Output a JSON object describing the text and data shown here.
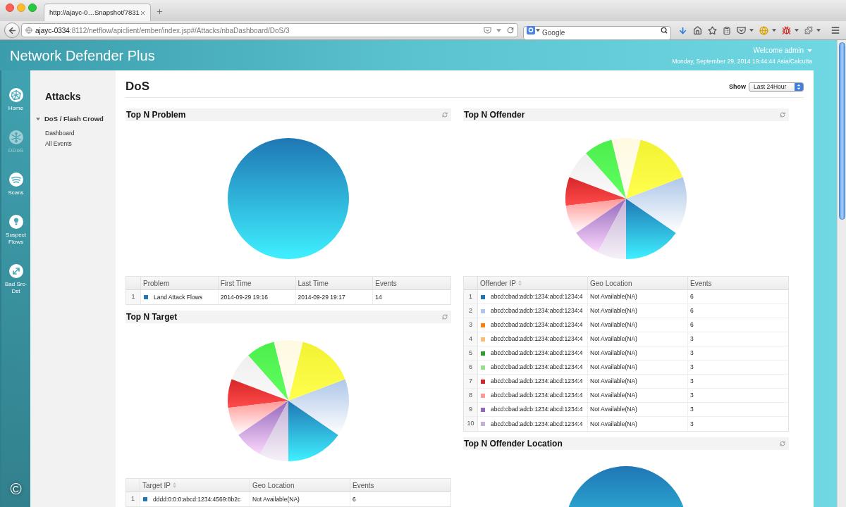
{
  "browser": {
    "tab_title": "http://ajayc-0…Snapshot/7831",
    "address": {
      "host": "ajayc-0334",
      "path": ":8112/netflow/apiclient/ember/index.jsp#/Attacks/nbaDashboard/DoS/3"
    },
    "search": {
      "placeholder": "Google"
    }
  },
  "header": {
    "title": "Network Defender Plus",
    "user": "Welcome admin",
    "datetime": "Monday, September 29, 2014 19:44:44 Asia/Calcutta"
  },
  "nav_rail": {
    "items": [
      {
        "label": "Home",
        "kind": "globe",
        "selected": false
      },
      {
        "label": "DDoS",
        "kind": "snowflake",
        "selected": true
      },
      {
        "label": "Scans",
        "kind": "waves",
        "selected": false
      },
      {
        "label": "Suspect Flows",
        "kind": "bulb",
        "selected": false
      },
      {
        "label": "Bad Src-Dst",
        "kind": "arrows",
        "selected": false
      }
    ],
    "footer": "©"
  },
  "sidebar": {
    "title": "Attacks",
    "groups": [
      {
        "label": "DoS / Flash Crowd",
        "expanded": true,
        "children": [
          {
            "label": "Dashboard"
          },
          {
            "label": "All Events"
          }
        ]
      }
    ]
  },
  "main": {
    "title": "DoS",
    "show": {
      "label": "Show",
      "value": "Last 24Hour"
    },
    "left_column": [
      {
        "title": "Top N Problem",
        "kind": "solid",
        "table": {
          "columns": [
            {
              "label": "Problem",
              "sortable": false
            },
            {
              "label": "First Time",
              "sortable": false
            },
            {
              "label": "Last Time",
              "sortable": false
            },
            {
              "label": "Events",
              "sortable": false
            }
          ],
          "rows": [
            {
              "index": "1",
              "color": "#1f77b4",
              "cells": [
                "Land Attack Flows",
                "2014-09-29 19:16",
                "2014-09-29 19:17",
                "14"
              ]
            }
          ]
        }
      },
      {
        "title": "Top N Target",
        "kind": "sliced",
        "table": {
          "columns": [
            {
              "label": "Target IP",
              "sortable": true
            },
            {
              "label": "Geo Location",
              "sortable": false
            },
            {
              "label": "Events",
              "sortable": false
            }
          ],
          "rows": [
            {
              "index": "1",
              "color": "#1f77b4",
              "cells": [
                "dddd:0:0:0:abcd:1234:4569:8b2c",
                "Not Available(NA)",
                "6"
              ]
            }
          ]
        }
      }
    ],
    "right_column": [
      {
        "title": "Top N Offender",
        "kind": "sliced",
        "table": {
          "columns": [
            {
              "label": "Offender IP",
              "sortable": true
            },
            {
              "label": "Geo Location",
              "sortable": false
            },
            {
              "label": "Events",
              "sortable": false
            }
          ],
          "rows": [
            {
              "index": "1",
              "color": "#1f77b4",
              "cells": [
                "abcd:cbad:adcb:1234:abcd:1234:4",
                "Not Available(NA)",
                "6"
              ]
            },
            {
              "index": "2",
              "color": "#aec7e8",
              "cells": [
                "abcd:cbad:adcb:1234:abcd:1234:4",
                "Not Available(NA)",
                "6"
              ]
            },
            {
              "index": "3",
              "color": "#ff7f0e",
              "cells": [
                "abcd:cbad:adcb:1234:abcd:1234:4",
                "Not Available(NA)",
                "6"
              ]
            },
            {
              "index": "4",
              "color": "#ffbb78",
              "cells": [
                "abcd:cbad:adcb:1234:abcd:1234:4",
                "Not Available(NA)",
                "3"
              ]
            },
            {
              "index": "5",
              "color": "#2ca02c",
              "cells": [
                "abcd:cbad:adcb:1234:abcd:1234:4",
                "Not Available(NA)",
                "3"
              ]
            },
            {
              "index": "6",
              "color": "#98df8a",
              "cells": [
                "abcd:cbad:adcb:1234:abcd:1234:4",
                "Not Available(NA)",
                "3"
              ]
            },
            {
              "index": "7",
              "color": "#d62728",
              "cells": [
                "abcd:cbad:adcb:1234:abcd:1234:4",
                "Not Available(NA)",
                "3"
              ]
            },
            {
              "index": "8",
              "color": "#ff9896",
              "cells": [
                "abcd:cbad:adcb:1234:abcd:1234:4",
                "Not Available(NA)",
                "3"
              ]
            },
            {
              "index": "9",
              "color": "#9467bd",
              "cells": [
                "abcd:cbad:adcb:1234:abcd:1234:4",
                "Not Available(NA)",
                "3"
              ]
            },
            {
              "index": "10",
              "color": "#c5b0d5",
              "cells": [
                "abcd:cbad:adcb:1234:abcd:1234:4",
                "Not Available(NA)",
                "3"
              ]
            }
          ]
        }
      },
      {
        "title": "Top N Offender Location",
        "kind": "solid"
      }
    ]
  }
}
